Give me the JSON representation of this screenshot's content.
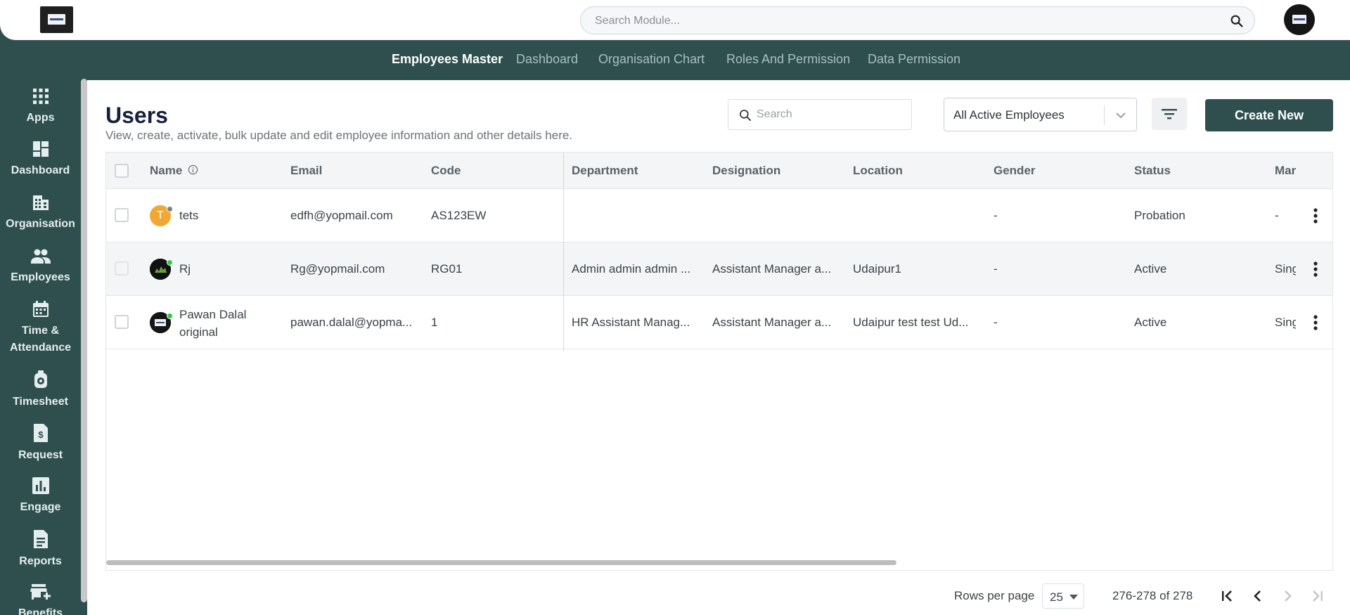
{
  "header": {
    "search_placeholder": "Search Module..."
  },
  "module_nav": {
    "tabs": [
      {
        "label": "Employees Master",
        "active": true
      },
      {
        "label": "Dashboard",
        "active": false
      },
      {
        "label": "Organisation Chart",
        "active": false
      },
      {
        "label": "Roles And Permission",
        "active": false
      },
      {
        "label": "Data Permission",
        "active": false
      }
    ]
  },
  "sidebar": {
    "items": [
      {
        "label": "Apps",
        "icon": "apps-grid-icon"
      },
      {
        "label": "Dashboard",
        "icon": "dashboard-icon"
      },
      {
        "label": "Organisation",
        "icon": "building-icon"
      },
      {
        "label": "Employees",
        "icon": "people-icon"
      },
      {
        "label": "Time & Attendance",
        "icon": "calendar-icon"
      },
      {
        "label": "Timesheet",
        "icon": "stopwatch-icon"
      },
      {
        "label": "Request",
        "icon": "dollar-document-icon"
      },
      {
        "label": "Engage",
        "icon": "bar-chart-icon"
      },
      {
        "label": "Reports",
        "icon": "report-document-icon"
      },
      {
        "label": "Benefits",
        "icon": "store-icon"
      }
    ]
  },
  "page": {
    "title": "Users",
    "subtitle": "View, create, activate, bulk update and edit employee information and other details here.",
    "search_placeholder": "Search",
    "filter_value": "All Active Employees",
    "create_label": "Create New"
  },
  "table": {
    "columns": [
      "Name",
      "Email",
      "Code",
      "Department",
      "Designation",
      "Location",
      "Gender",
      "Status",
      "Mar"
    ],
    "rows": [
      {
        "avatar_letter": "T",
        "name": "tets",
        "email": "edfh@yopmail.com",
        "code": "AS123EW",
        "department": "",
        "designation": "",
        "location": "",
        "gender": "-",
        "status": "Probation",
        "manager": "-"
      },
      {
        "avatar_letter": "",
        "name": "Rj",
        "email": "Rg@yopmail.com",
        "code": "RG01",
        "department": "Admin admin admin ...",
        "designation": "Assistant Manager a...",
        "location": "Udaipur1",
        "gender": "-",
        "status": "Active",
        "manager": "Sing"
      },
      {
        "avatar_letter": "",
        "name": "Pawan Dalal original",
        "name_line1": "Pawan Dalal",
        "name_line2": "original",
        "email": "pawan.dalal@yopma...",
        "code": "1",
        "department": "HR Assistant Manag...",
        "designation": "Assistant Manager a...",
        "location": "Udaipur test test Ud...",
        "gender": "-",
        "status": "Active",
        "manager": "Sing"
      }
    ]
  },
  "pagination": {
    "rows_per_page_label": "Rows per page",
    "rows_per_page": "25",
    "range": "276-278 of 278"
  },
  "colors": {
    "brand": "#2f4f4f",
    "avatar_orange": "#f0a832",
    "online_green": "#2ecc40"
  }
}
